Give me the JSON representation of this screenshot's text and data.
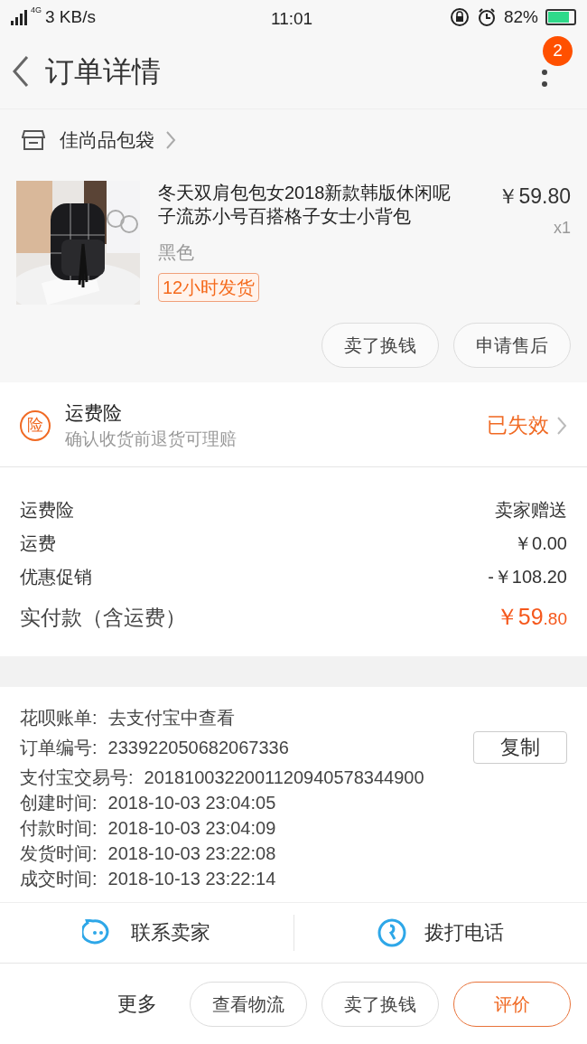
{
  "status_bar": {
    "network": "4G",
    "speed": "3 KB/s",
    "time": "11:01",
    "battery": "82%"
  },
  "header": {
    "title": "订单详情",
    "badge": "2"
  },
  "shop": {
    "name": "佳尚品包袋"
  },
  "product": {
    "title": "冬天双肩包包女2018新款韩版休闲呢子流苏小号百搭格子女士小背包",
    "price": "￥59.80",
    "quantity": "x1",
    "variant": "黑色",
    "tag": "12小时发货"
  },
  "item_actions": [
    "卖了换钱",
    "申请售后"
  ],
  "insurance": {
    "title": "运费险",
    "subtitle": "确认收货前退货可理赔",
    "status": "已失效",
    "icon": "险"
  },
  "costs": [
    {
      "label": "运费险",
      "value": "卖家赠送"
    },
    {
      "label": "运费",
      "value": "￥0.00"
    },
    {
      "label": "优惠促销",
      "value": "-￥108.20"
    }
  ],
  "total": {
    "label": "实付款（含运费）",
    "amount_main": "￥59",
    "amount_decimal": ".80"
  },
  "info": [
    {
      "label": "花呗账单:",
      "value": "去支付宝中查看"
    },
    {
      "label": "订单编号:",
      "value": "233922050682067336",
      "action": "复制"
    },
    {
      "label": "支付宝交易号:",
      "value": "2018100322001120940578344900"
    },
    {
      "label": "创建时间:",
      "value": "2018-10-03 23:04:05"
    },
    {
      "label": "付款时间:",
      "value": "2018-10-03 23:04:09"
    },
    {
      "label": "发货时间:",
      "value": "2018-10-03 23:22:08"
    },
    {
      "label": "成交时间:",
      "value": "2018-10-13 23:22:14"
    }
  ],
  "contact": [
    {
      "kind": "chat",
      "label": "联系卖家"
    },
    {
      "kind": "phone",
      "label": "拨打电话"
    }
  ],
  "bottom_bar": {
    "more": "更多",
    "buttons": [
      {
        "label": "查看物流",
        "primary": false
      },
      {
        "label": "卖了换钱",
        "primary": false
      },
      {
        "label": "评价",
        "primary": true
      }
    ]
  }
}
